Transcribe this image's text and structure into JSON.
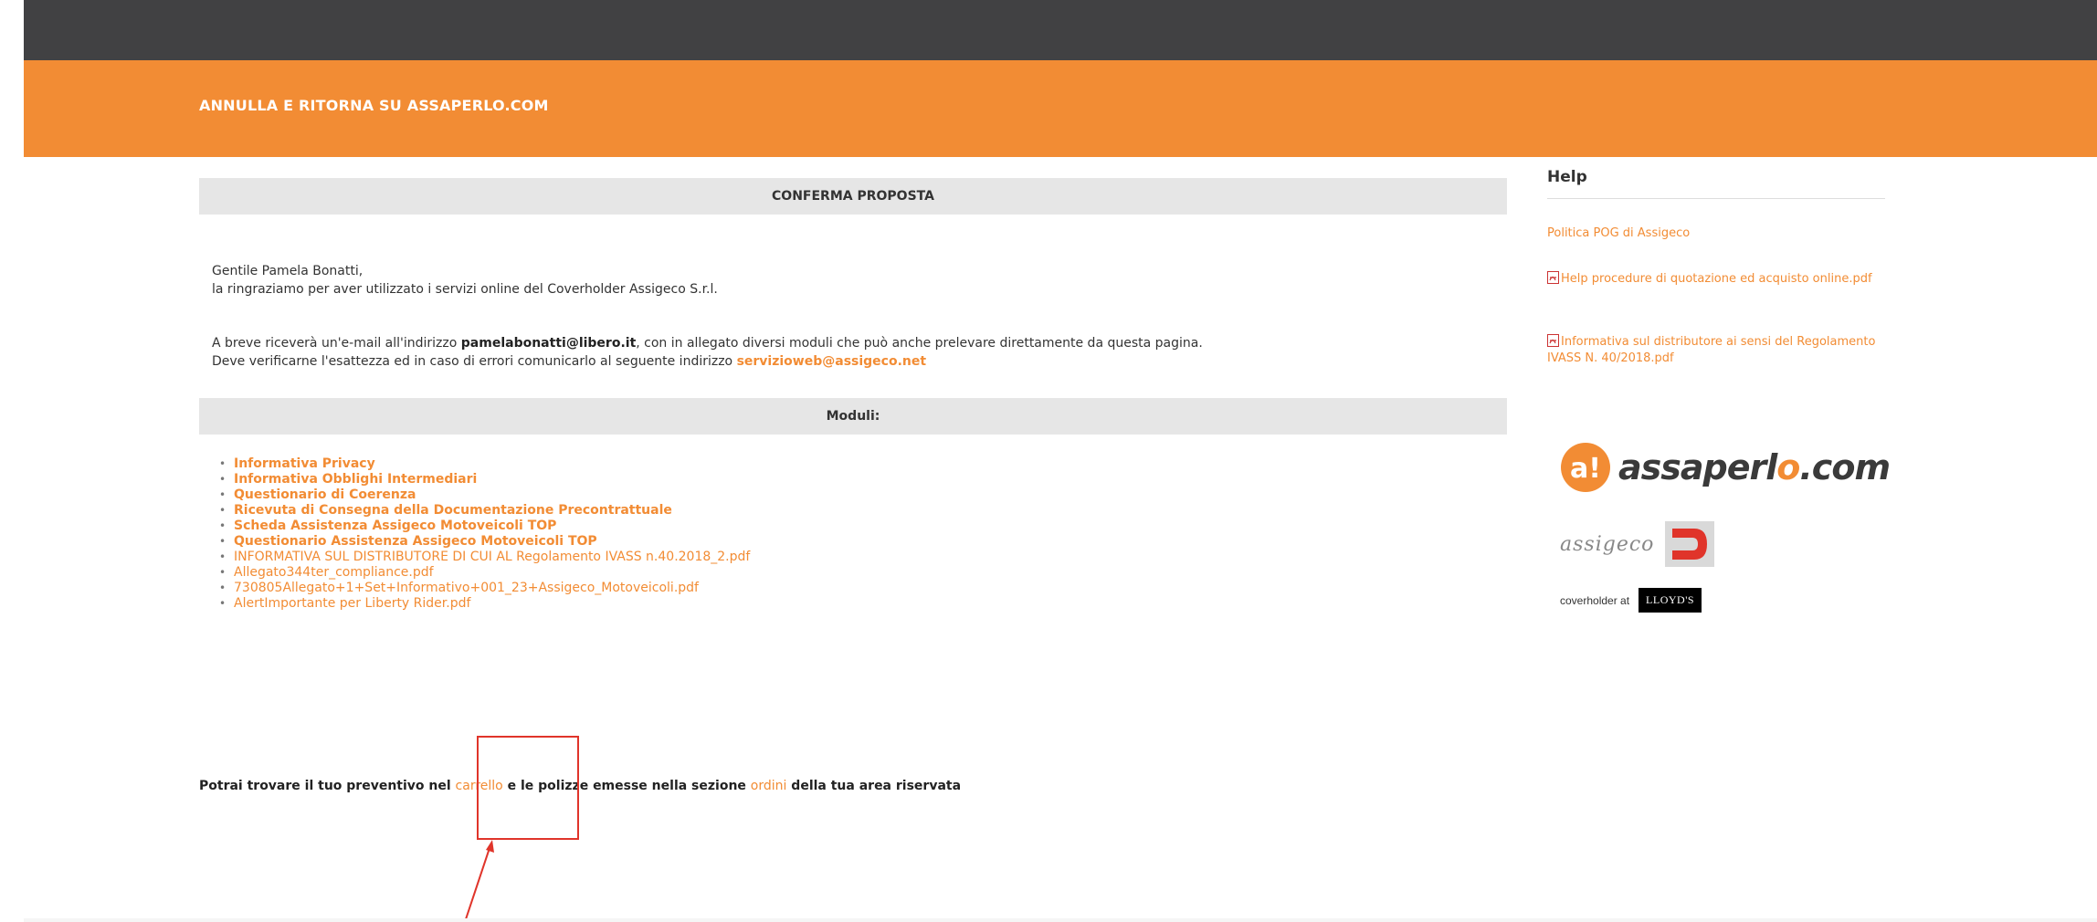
{
  "header": {
    "cancel_link": "ANNULLA E RITORNA SU ASSAPERLO.COM"
  },
  "main": {
    "confirm_title": "CONFERMA PROPOSTA",
    "greeting": "Gentile Pamela Bonatti,",
    "thanks": "la ringraziamo per aver utilizzato i servizi online del Coverholder Assigeco S.r.l.",
    "email_line_before": "A breve riceverà un'e-mail all'indirizzo ",
    "email": "pamelabonatti@libero.it",
    "email_line_after": ", con in allegato diversi moduli che può anche prelevare direttamente da questa pagina.",
    "verify_line": "Deve verificarne l'esattezza ed in caso di errori comunicarlo al seguente indirizzo ",
    "support_email": "servizioweb@assigeco.net",
    "moduli_title": "Moduli:",
    "moduli": [
      "Informativa Privacy",
      "Informativa Obblighi Intermediari",
      "Questionario di Coerenza",
      "Ricevuta di Consegna della Documentazione Precontrattuale",
      "Scheda Assistenza Assigeco Motoveicoli TOP",
      "Questionario Assistenza Assigeco Motoveicoli TOP",
      "INFORMATIVA SUL DISTRIBUTORE DI CUI AL Regolamento IVASS n.40.2018_2.pdf",
      "Allegato344ter_compliance.pdf",
      "730805Allegato+1+Set+Informativo+001_23+Assigeco_Motoveicoli.pdf",
      "AlertImportante per Liberty Rider.pdf"
    ],
    "footer_before": "Potrai trovare il tuo preventivo nel ",
    "footer_cart": "carrello",
    "footer_middle": " e le polizze emesse nella sezione ",
    "footer_orders": "ordini",
    "footer_after": " della tua area riservata"
  },
  "sidebar": {
    "help_title": "Help",
    "links": [
      "Politica POG di Assigeco",
      "Help procedure di quotazione ed acquisto online.pdf",
      "Informativa sul distributore ai sensi del Regolamento IVASS N. 40/2018.pdf"
    ],
    "assaperlo_logo_a": "a!",
    "assaperlo_logo_text1": "assaperl",
    "assaperlo_logo_o": "o",
    "assaperlo_logo_text2": ".com",
    "assigeco_logo_text": "assigeco",
    "coverholder_text": "coverholder at",
    "lloyds_text": "LLOYD'S"
  },
  "colors": {
    "accent": "#f28c34",
    "topbar": "#414143",
    "annotation": "#e0342a"
  }
}
